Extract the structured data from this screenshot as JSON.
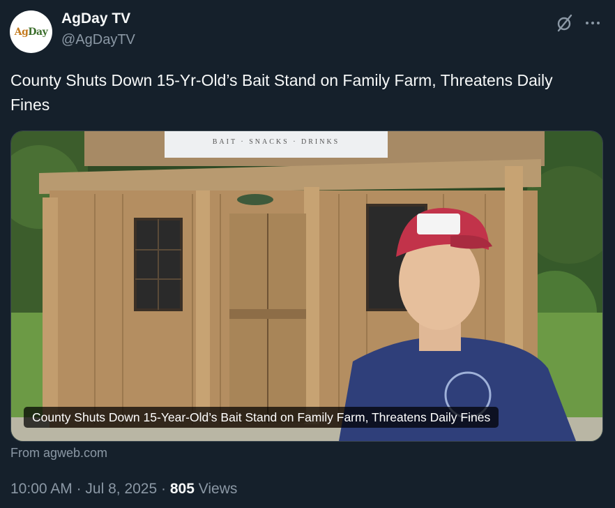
{
  "author": {
    "avatar_text": "AGDAY",
    "name": "AgDay TV",
    "handle": "@AgDayTV"
  },
  "tweet": {
    "text": "County Shuts Down 15-Yr-Old’s Bait Stand on Family Farm, Threatens Daily Fines"
  },
  "card": {
    "caption": "County Shuts Down 15-Year-Old’s Bait Stand on Family Farm, Threatens Daily Fines",
    "sign_text": "BAIT · SNACKS · DRINKS",
    "source": "From agweb.com"
  },
  "meta": {
    "time": "10:00 AM",
    "sep1": "·",
    "date": "Jul 8, 2025",
    "sep2": "·",
    "views_count": "805",
    "views_label": "Views"
  },
  "icons": {
    "grok": "grok-icon",
    "more": "more-dots-icon"
  },
  "colors": {
    "background": "#15202b",
    "primary_text": "#f7f9f9",
    "secondary_text": "#8b98a5"
  }
}
